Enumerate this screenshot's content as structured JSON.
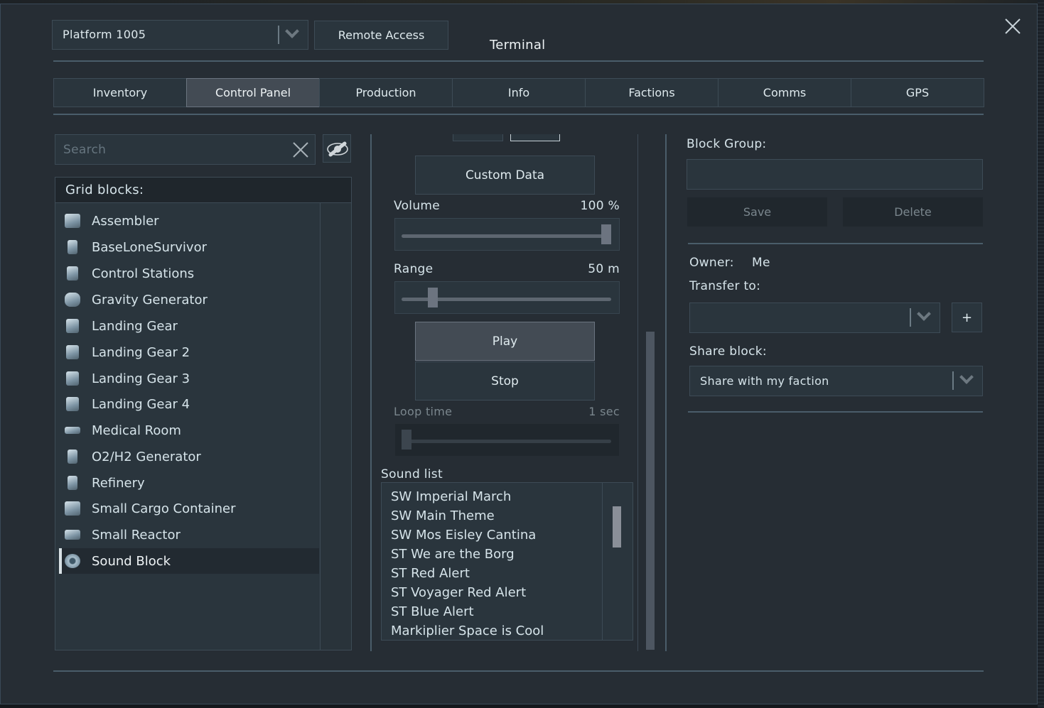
{
  "window": {
    "title": "Terminal",
    "close_icon": "close-x-icon"
  },
  "header": {
    "grid_selector": {
      "value": "Platform 1005",
      "icon": "chevron-down-icon"
    },
    "remote_access_label": "Remote Access"
  },
  "tabs": [
    {
      "label": "Inventory",
      "active": false
    },
    {
      "label": "Control Panel",
      "active": true
    },
    {
      "label": "Production",
      "active": false
    },
    {
      "label": "Info",
      "active": false
    },
    {
      "label": "Factions",
      "active": false
    },
    {
      "label": "Comms",
      "active": false
    },
    {
      "label": "GPS",
      "active": false
    }
  ],
  "left_panel": {
    "search": {
      "placeholder": "Search",
      "value": "",
      "clear_icon": "clear-x-icon"
    },
    "visibility_toggle_icon": "eye-hidden-icon",
    "grid_blocks_header": "Grid blocks:",
    "blocks": [
      {
        "label": "Assembler",
        "icon": "assembler-icon",
        "selected": false
      },
      {
        "label": "BaseLoneSurvivor",
        "icon": "survival-kit-icon",
        "selected": false
      },
      {
        "label": "Control Stations",
        "icon": "control-station-icon",
        "selected": false
      },
      {
        "label": "Gravity Generator",
        "icon": "gravity-generator-icon",
        "selected": false
      },
      {
        "label": "Landing Gear",
        "icon": "landing-gear-icon",
        "selected": false
      },
      {
        "label": "Landing Gear 2",
        "icon": "landing-gear-icon",
        "selected": false
      },
      {
        "label": "Landing Gear 3",
        "icon": "landing-gear-icon",
        "selected": false
      },
      {
        "label": "Landing Gear 4",
        "icon": "landing-gear-icon",
        "selected": false
      },
      {
        "label": "Medical Room",
        "icon": "medical-room-icon",
        "selected": false
      },
      {
        "label": "O2/H2 Generator",
        "icon": "o2h2-generator-icon",
        "selected": false
      },
      {
        "label": "Refinery",
        "icon": "refinery-icon",
        "selected": false
      },
      {
        "label": "Small Cargo Container",
        "icon": "cargo-container-icon",
        "selected": false
      },
      {
        "label": "Small Reactor",
        "icon": "reactor-icon",
        "selected": false
      },
      {
        "label": "Sound Block",
        "icon": "sound-block-icon",
        "selected": true
      }
    ]
  },
  "middle_panel": {
    "custom_data_label": "Custom Data",
    "volume": {
      "label": "Volume",
      "value_text": "100 %",
      "fraction": 1.0
    },
    "range": {
      "label": "Range",
      "value_text": "50 m",
      "fraction": 0.13
    },
    "play_label": "Play",
    "stop_label": "Stop",
    "loop_time": {
      "label": "Loop time",
      "value_text": "1 sec",
      "fraction": 0.0,
      "disabled": true
    },
    "sound_list_label": "Sound list",
    "sounds": [
      "SW Imperial March",
      "SW Main Theme",
      "SW Mos Eisley Cantina",
      "ST We are the Borg",
      "ST Red Alert",
      "ST Voyager Red Alert",
      "ST Blue Alert",
      "Markiplier Space is Cool"
    ]
  },
  "right_panel": {
    "block_group_label": "Block Group:",
    "block_group_value": "",
    "save_label": "Save",
    "delete_label": "Delete",
    "owner_label": "Owner:",
    "owner_value": "Me",
    "transfer_label": "Transfer to:",
    "transfer_value": "",
    "add_label": "+",
    "share_label": "Share block:",
    "share_value": "Share with my faction"
  }
}
